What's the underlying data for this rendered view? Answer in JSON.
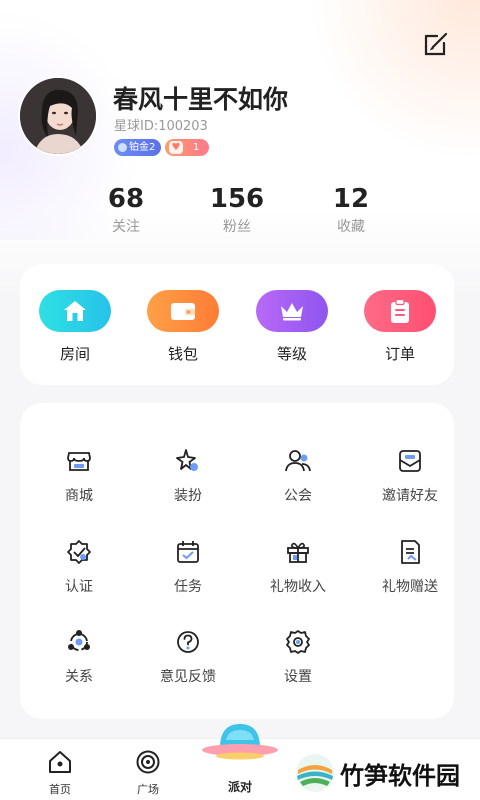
{
  "profile": {
    "nickname": "春风十里不如你",
    "star_id": "星球ID:100203",
    "badge_level": "铂金2",
    "badge_heart_count": "1"
  },
  "stats": [
    {
      "value": "68",
      "label": "关注"
    },
    {
      "value": "156",
      "label": "粉丝"
    },
    {
      "value": "12",
      "label": "收藏"
    }
  ],
  "quick_actions": [
    {
      "label": "房间",
      "icon": "home-icon"
    },
    {
      "label": "钱包",
      "icon": "wallet-icon"
    },
    {
      "label": "等级",
      "icon": "crown-icon"
    },
    {
      "label": "订单",
      "icon": "clipboard-icon"
    }
  ],
  "menu": [
    {
      "label": "商城",
      "icon": "store-icon"
    },
    {
      "label": "装扮",
      "icon": "sparkle-icon"
    },
    {
      "label": "公会",
      "icon": "users-icon"
    },
    {
      "label": "邀请好友",
      "icon": "invite-mail-icon"
    },
    {
      "label": "认证",
      "icon": "verified-badge-icon"
    },
    {
      "label": "任务",
      "icon": "calendar-check-icon"
    },
    {
      "label": "礼物收入",
      "icon": "gift-icon"
    },
    {
      "label": "礼物赠送",
      "icon": "gift-send-doc-icon"
    },
    {
      "label": "关系",
      "icon": "relation-icon"
    },
    {
      "label": "意见反馈",
      "icon": "question-icon"
    },
    {
      "label": "设置",
      "icon": "gear-icon"
    }
  ],
  "tabbar": [
    {
      "label": "首页",
      "icon": "home-outline-icon"
    },
    {
      "label": "广场",
      "icon": "target-icon"
    },
    {
      "label": "派对",
      "icon": "ufo-icon"
    }
  ],
  "watermark": {
    "text": "竹笋软件园",
    "icon": "bamboo-logo-icon"
  },
  "colors": {
    "room": "#27d3e0",
    "wallet": "#ff8a3d",
    "level": "#a35cf2",
    "order": "#ff5a7a",
    "accent_blue": "#5b8cf7"
  }
}
